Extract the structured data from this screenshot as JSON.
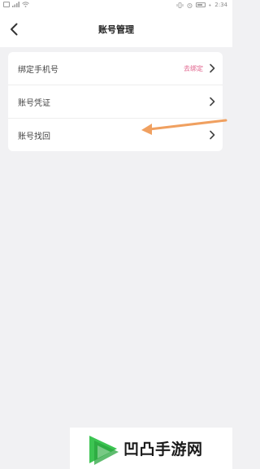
{
  "status_bar": {
    "time": "2:34",
    "icons": [
      "sim-icon",
      "signal-icon",
      "wifi-icon",
      "vibrate-icon",
      "alarm-icon",
      "battery-icon",
      "charging-icon"
    ]
  },
  "header": {
    "title": "账号管理",
    "back_icon": "chevron-left-icon"
  },
  "settings": {
    "items": [
      {
        "label": "绑定手机号",
        "value": "去绑定",
        "icon": "chevron-right-icon"
      },
      {
        "label": "账号凭证",
        "icon": "chevron-right-icon"
      },
      {
        "label": "账号找回",
        "icon": "chevron-right-icon"
      }
    ]
  },
  "annotation": {
    "arrow_color": "#f0a060"
  },
  "watermark": {
    "text": "凹凸手游网",
    "accent_color": "#3cc452"
  }
}
